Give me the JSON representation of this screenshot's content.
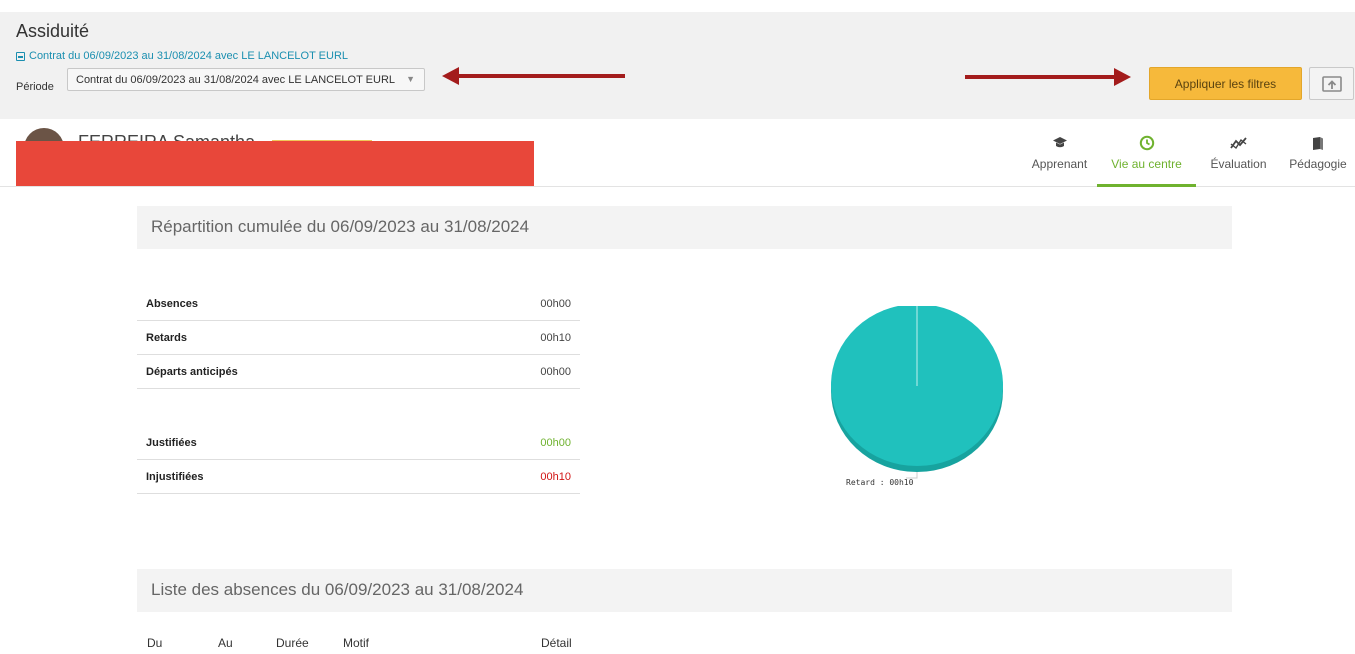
{
  "header": {
    "title": "Assiduité",
    "contract_link": "Contrat du 06/09/2023 au 31/08/2024 avec LE LANCELOT EURL",
    "periode_label": "Période",
    "periode_value": "Contrat du 06/09/2023 au 31/08/2024 avec LE LANCELOT EURL",
    "apply_label": "Appliquer les filtres",
    "export_icon": "export-icon",
    "accent_color": "#f6b93b",
    "annotation_arrow_color": "#a31c1c"
  },
  "profile": {
    "name": "FERREIRA Samantha",
    "redaction_color": "#e8473a"
  },
  "tabs": [
    {
      "label": "Apprenant",
      "icon": "graduation-cap-icon",
      "active": false
    },
    {
      "label": "Vie au centre",
      "icon": "clock-icon",
      "active": true
    },
    {
      "label": "Évaluation",
      "icon": "chart-line-icon",
      "active": false
    },
    {
      "label": "Pédagogie",
      "icon": "book-icon",
      "active": false
    }
  ],
  "repartition": {
    "title": "Répartition cumulée du 06/09/2023 au 31/08/2024",
    "rows": [
      {
        "label": "Absences",
        "value": "00h00"
      },
      {
        "label": "Retards",
        "value": "00h10"
      },
      {
        "label": "Départs anticipés",
        "value": "00h00"
      }
    ],
    "justif_rows": [
      {
        "label": "Justifiées",
        "value": "00h00",
        "color": "#6fb22f"
      },
      {
        "label": "Injustifiées",
        "value": "00h10",
        "color": "#d11414"
      }
    ],
    "pie_label": "Retard : 00h10",
    "pie_color": "#20c1bd"
  },
  "absences_list": {
    "title": "Liste des absences du 06/09/2023 au 31/08/2024",
    "columns": [
      "Du",
      "Au",
      "Durée",
      "Motif",
      "Détail"
    ]
  },
  "chart_data": {
    "type": "pie",
    "labels": [
      "Retard"
    ],
    "values": [
      10
    ],
    "data_labels": [
      "Retard : 00h10"
    ]
  }
}
